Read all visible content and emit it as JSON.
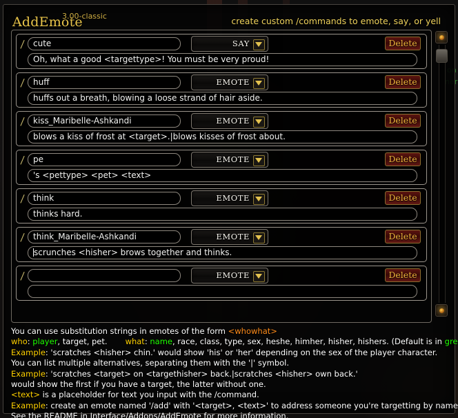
{
  "header": {
    "title": "AddEmote",
    "version": "3.00-classic",
    "tagline": "create custom /commands to emote, say, or yell"
  },
  "colors": {
    "title_gold": "#e8c44a",
    "tagline_gold": "#edd05a",
    "delete_text": "#f0b43c",
    "delete_bg": "#5c1410",
    "input_border": "#8e887f",
    "slash_gold": "#c9b96e",
    "help_keyword_yellow": "#ffd100",
    "help_keyword_green": "#1eff00",
    "help_keyword_orange": "#ff8c1a",
    "panel_border": "#4a4540"
  },
  "list": {
    "slash_glyph": "/",
    "delete_label": "Delete",
    "dropdown_arrow_icon": "chevron-down-icon",
    "rows": [
      {
        "command": "cute",
        "channel": "SAY",
        "text": "Oh, what a good <targettype>! You must be very proud!",
        "caret": false
      },
      {
        "command": "huff",
        "channel": "EMOTE",
        "text": "huffs out a breath, blowing a loose strand of hair aside.",
        "caret": false
      },
      {
        "command": "kiss_Maribelle-Ashkandi",
        "channel": "EMOTE",
        "text": "blows a kiss of frost at <target>.|blows kisses of frost about.",
        "caret": false
      },
      {
        "command": "pe",
        "channel": "EMOTE",
        "text": "'s <pettype> <pet> <text>",
        "caret": false
      },
      {
        "command": "think",
        "channel": "EMOTE",
        "text": "thinks hard.",
        "caret": false
      },
      {
        "command": "think_Maribelle-Ashkandi",
        "channel": "EMOTE",
        "text": "scrunches <hisher> brows together and thinks.",
        "caret": true
      },
      {
        "command": "",
        "channel": "EMOTE",
        "text": "",
        "caret": false
      }
    ]
  },
  "scrollbar": {
    "up_icon": "scroll-up-arrow-icon",
    "down_icon": "scroll-down-arrow-icon"
  },
  "help": {
    "line1_a": "You can use substitution strings in emotes of the form ",
    "line1_b": "<whowhat>",
    "line2_a": "who",
    "line2_b": ": ",
    "line2_c": "player",
    "line2_d": ", target, pet.",
    "line2_e": "what",
    "line2_f": ": ",
    "line2_g": "name",
    "line2_h": ", race, class, type, sex, heshe, himher, hisher, hishers. (Default is in ",
    "line2_i": "green",
    "line2_j": ")",
    "line3_a": "Example",
    "line3_b": ": 'scratches <hisher> chin.' would show 'his' or 'her' depending on the sex of the player character.",
    "line4": "You can list multiple alternatives, separating them with the '|' symbol.",
    "line5_a": "Example",
    "line5_b": ": 'scratches <target> on <targethisher> back.|scratches <hisher> own back.'",
    "line6": "would show the first if you have a target, the latter without one.",
    "line7_a": "<text>",
    "line7_b": " is a placeholder for text you input with the /command.",
    "line8_a": "Example",
    "line8_b": ": create an emote named '/add' with '<target>, <text>' to address someone you're targetting by name.",
    "line9": "See the README in Interface/Addons/AddEmote for more information."
  },
  "background": {
    "chat_fragment_1": "on",
    "chat_fragment_2": "ner"
  }
}
